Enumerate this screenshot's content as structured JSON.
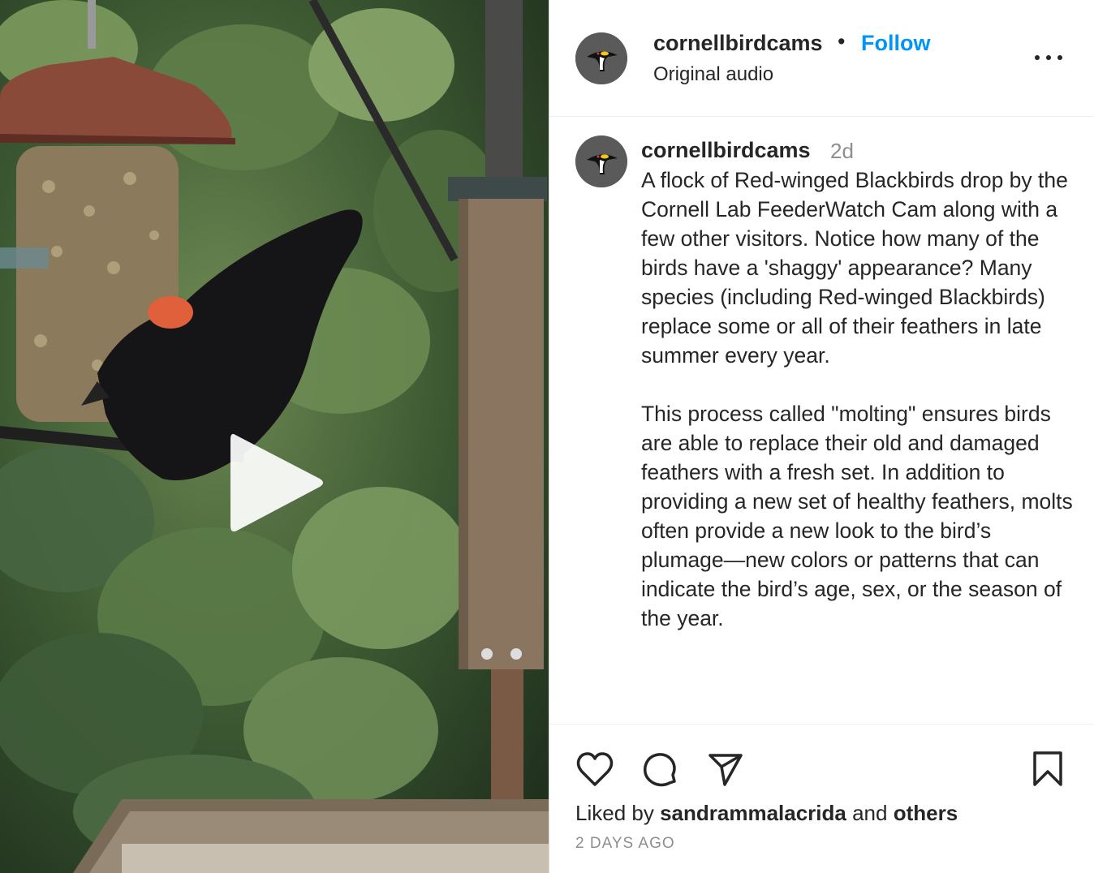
{
  "media": {
    "description_icon": "play-icon"
  },
  "header": {
    "username": "cornellbirdcams",
    "separator": "•",
    "follow_label": "Follow",
    "audio_label": "Original audio",
    "more_icon": "more-options-icon"
  },
  "caption": {
    "username": "cornellbirdcams",
    "time": "2d",
    "paragraphs": [
      "A flock of Red-winged Blackbirds drop by the Cornell Lab FeederWatch Cam along with a few other visitors. Notice how many of the birds have a 'shaggy' appearance? Many species (including Red-winged Blackbirds) replace some or all of their feathers in late summer every year.",
      "This process called \"molting\" ensures birds are able to replace their old and damaged feathers with a fresh set. In addition to providing a new set of healthy feathers, molts often provide a new look to the bird’s plumage—new colors or patterns that can indicate the bird’s age, sex, or the season of the year."
    ]
  },
  "actions": {
    "like_icon": "heart-icon",
    "comment_icon": "comment-icon",
    "share_icon": "share-icon",
    "save_icon": "bookmark-icon",
    "liked_by_prefix": "Liked by ",
    "liked_by_user": "sandrammalacrida",
    "liked_by_middle": " and ",
    "liked_by_others": "others",
    "date": "2 DAYS AGO"
  },
  "colors": {
    "accent": "#0095f6",
    "text": "#262626",
    "muted": "#8e8e8e"
  }
}
